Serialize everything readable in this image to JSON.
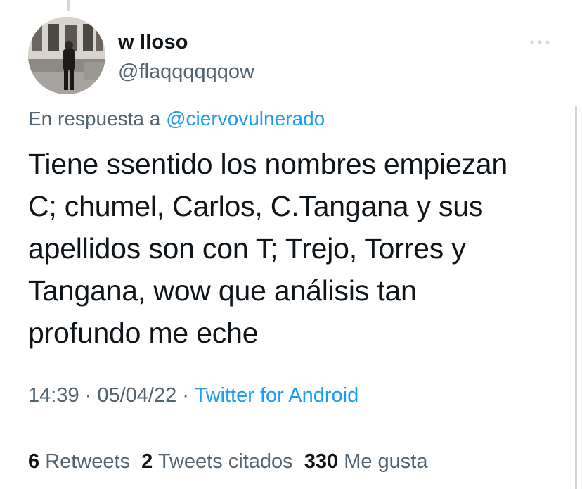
{
  "author": {
    "name": "w lloso",
    "handle": "@flaqqqqqqow"
  },
  "reply": {
    "prefix": "En respuesta a",
    "mention": "@ciervovulnerado"
  },
  "tweet": {
    "lines": [
      "Tiene ssentido los nombres empiezan",
      "C; chumel, Carlos, C.Tangana y sus",
      "apellidos son con T; Trejo, Torres y",
      "Tangana, wow que análisis tan",
      "profundo me eche"
    ]
  },
  "meta": {
    "time": "14:39",
    "sep1": " · ",
    "date": "05/04/22",
    "sep2": " · ",
    "source": "Twitter for Android"
  },
  "stats": {
    "retweets_count": "6",
    "retweets_label": "Retweets",
    "quotes_count": "2",
    "quotes_label": "Tweets citados",
    "likes_count": "330",
    "likes_label": "Me gusta"
  },
  "icons": {
    "more": "more-options-icon"
  },
  "colors": {
    "accent": "#1d9bf0",
    "secondary_text": "#536471",
    "primary_text": "#0f1419"
  }
}
